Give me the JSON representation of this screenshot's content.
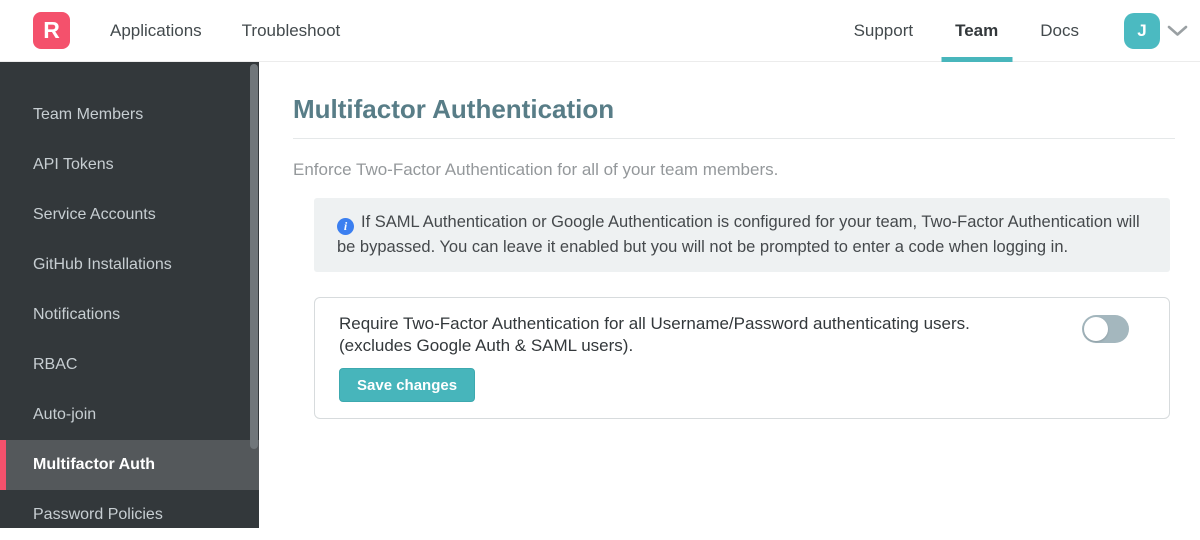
{
  "header": {
    "logo_letter": "R",
    "nav_left": [
      {
        "label": "Applications"
      },
      {
        "label": "Troubleshoot"
      }
    ],
    "nav_right": [
      {
        "label": "Support"
      },
      {
        "label": "Team"
      },
      {
        "label": "Docs"
      }
    ],
    "active_tab": "Team",
    "avatar_initial": "J"
  },
  "sidebar": {
    "items": [
      {
        "label": "Team Members"
      },
      {
        "label": "API Tokens"
      },
      {
        "label": "Service Accounts"
      },
      {
        "label": "GitHub Installations"
      },
      {
        "label": "Notifications"
      },
      {
        "label": "RBAC"
      },
      {
        "label": "Auto-join"
      },
      {
        "label": "Multifactor Auth"
      },
      {
        "label": "Password Policies"
      }
    ],
    "active_item": "Multifactor Auth"
  },
  "main": {
    "title": "Multifactor Authentication",
    "description": "Enforce Two-Factor Authentication for all of your team members.",
    "info_icon": "info-circle-icon",
    "info_note": "If SAML Authentication or Google Authentication is configured for your team, Two-Factor Authentication will be bypassed. You can leave it enabled but you will not be prompted to enter a code when logging in.",
    "setting": {
      "line1": "Require Two-Factor Authentication for all Username/Password authenticating users.",
      "line2": "(excludes Google Auth & SAML users).",
      "toggle_state": "off",
      "save_label": "Save changes"
    }
  },
  "colors": {
    "brand_red": "#f4516c",
    "teal_accent": "#48b6bc",
    "heading_teal": "#587d87",
    "sidebar_bg": "#33383b",
    "sidebar_active_bg": "#54585b",
    "info_bg": "#eef1f2",
    "info_icon_blue": "#3b7ff0",
    "toggle_off_track": "#a4b7be"
  }
}
